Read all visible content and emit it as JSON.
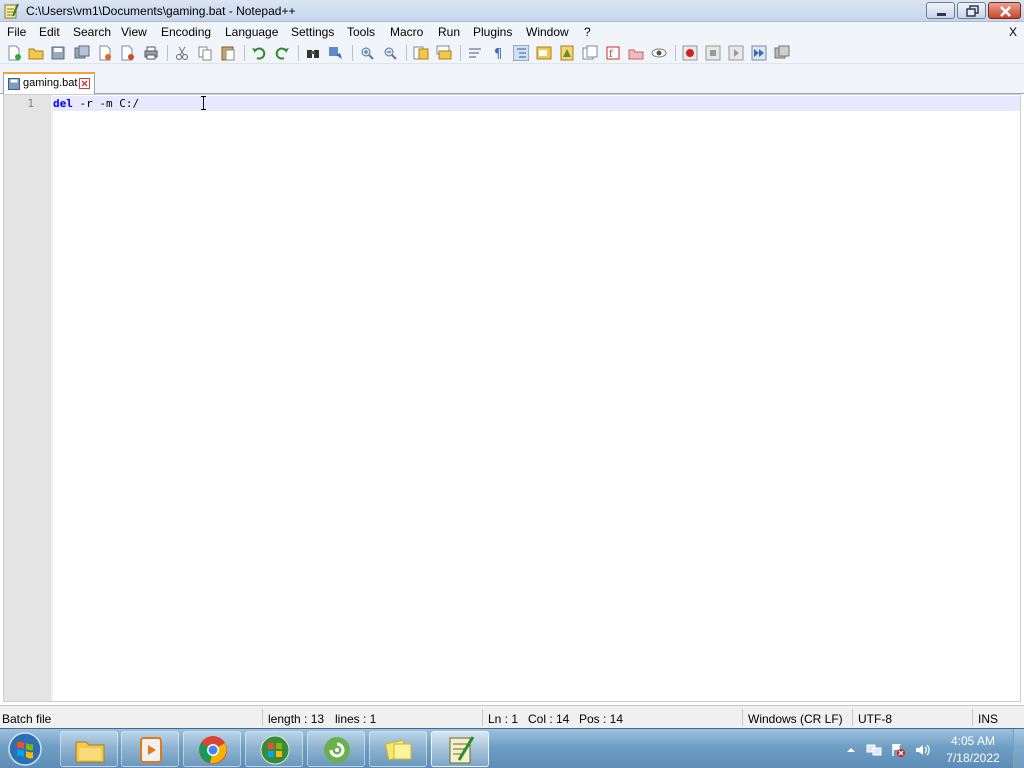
{
  "window": {
    "title": "C:\\Users\\vm1\\Documents\\gaming.bat - Notepad++"
  },
  "menu": {
    "items": [
      "File",
      "Edit",
      "Search",
      "View",
      "Encoding",
      "Language",
      "Settings",
      "Tools",
      "Macro",
      "Run",
      "Plugins",
      "Window",
      "?"
    ],
    "close_doc": "X"
  },
  "tabs": [
    {
      "label": "gaming.bat"
    }
  ],
  "editor": {
    "line_numbers": [
      "1"
    ],
    "keyword": "del",
    "rest": " -r -m C:/"
  },
  "status": {
    "lang": "Batch file",
    "length": "length : 13",
    "lines": "lines : 1",
    "ln": "Ln : 1",
    "col": "Col : 14",
    "pos": "Pos : 14",
    "eol": "Windows (CR LF)",
    "encoding": "UTF-8",
    "mode": "INS"
  },
  "taskbar": {
    "apps": [
      "file-explorer",
      "media-player",
      "chrome",
      "start-menu-app",
      "cortana-app",
      "sticky-notes",
      "notepad-plus-plus"
    ],
    "time": "4:05 AM",
    "date": "7/18/2022"
  },
  "colors": {
    "keyword": "#0000ff",
    "current_line": "#e8e8ff",
    "tab_accent": "#f4a13a"
  }
}
